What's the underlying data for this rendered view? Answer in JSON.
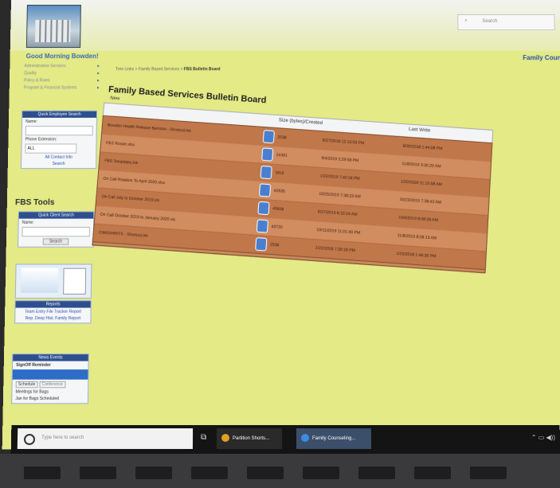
{
  "header": {
    "greeting": "Good Morning Bowden!",
    "search_text": "Search",
    "top_link": "Family Coun"
  },
  "left_nav": {
    "items": [
      "Administrative Services",
      "Quality",
      "Policy & Rules",
      "Program & Financial Systems"
    ]
  },
  "quick_employee_search": {
    "title": "Quick Employee Search",
    "name_label": "Name:",
    "phone_label": "Phone Extension:",
    "dropdown_value": "ALL",
    "link_text": "All Contact Info",
    "search_button": "Search"
  },
  "pbs_tools": {
    "title": "FBS Tools",
    "quick_client_title": "Quick Client Search",
    "name_label": "Name:",
    "search_button": "Search",
    "reports_title": "Reports",
    "report_links": [
      "Team Entry File Tracker Report",
      "Rep. Deep Hist. Family Report"
    ],
    "news_title": "News Events",
    "news_item": "SignOff Reminder",
    "tab_active": "Schedule",
    "tab_other": "Conference",
    "footer_items": [
      "Meetings for Bags",
      "Jan for Bags Scheduled"
    ]
  },
  "breadcrumbs": {
    "parent": "Tree Links > Family Based Services",
    "current": "FBS Bulletin Board"
  },
  "bulletin": {
    "title": "Family Based Services Bulletin Board",
    "new_label": "New",
    "columns": {
      "size": "Size (bytes)/Created",
      "last_write": "Last Write"
    },
    "rows": [
      {
        "name": "Bowden Health Release Bariston - Shortcut.lnk",
        "size": "2538",
        "created": "8/27/2018 12:10:53 PM",
        "last_write": "8/30/2018 1:44:08 PM"
      },
      {
        "name": "FBS Roster.xlsx",
        "size": "24361",
        "created": "9/4/2019 2:29:58 PM",
        "last_write": "11/8/2019 3:30:20 AM"
      },
      {
        "name": "FBS Templates.lnk",
        "size": "1816",
        "created": "1/22/2019 7:40:18 PM",
        "last_write": "1/20/2020 11:10:58 AM"
      },
      {
        "name": "On Call Rotation To April 2020.xlsx",
        "size": "42635",
        "created": "10/25/2019 7:38:23 AM",
        "last_write": "10/23/2019 7:38:43 AM"
      },
      {
        "name": "On Call July to October 2019.xls",
        "size": "45608",
        "created": "6/27/2019 8:10:24 AM",
        "last_write": "10/4/2019 8:08:28 AM"
      },
      {
        "name": "On Call October 2019 to January 2020.xls",
        "size": "43720",
        "created": "10/11/2019 11:01:40 PM",
        "last_write": "11/8/2019 8:28:13 AM"
      },
      {
        "name": "CIMIS/HRITS - Shortcut.lnk",
        "size": "2538",
        "created": "1/22/2018 7:30:18 PM",
        "last_write": "1/23/2018 1:46:30 PM"
      }
    ]
  },
  "taskbar": {
    "search_placeholder": "Type here to search",
    "app1": "Partition Shorts...",
    "app2": "Family Counseling..."
  },
  "colors": {
    "page_bg": "#e3ea86",
    "table_row": "#c98a5c",
    "nav_header": "#2d4f8f",
    "link": "#2a4fb0"
  }
}
